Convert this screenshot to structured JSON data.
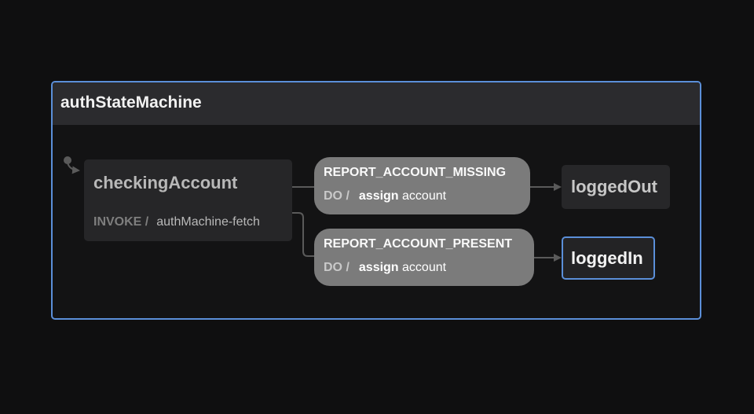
{
  "machine": {
    "title": "authStateMachine"
  },
  "states": {
    "checking": {
      "name": "checkingAccount",
      "invoke_keyword": "INVOKE /",
      "invoke_src": "authMachine-fetch"
    },
    "logged_out": {
      "name": "loggedOut"
    },
    "logged_in": {
      "name": "loggedIn"
    }
  },
  "events": {
    "missing": {
      "name": "REPORT_ACCOUNT_MISSING",
      "do_keyword": "DO /",
      "action": "assign",
      "action_arg": "account"
    },
    "present": {
      "name": "REPORT_ACCOUNT_PRESENT",
      "do_keyword": "DO /",
      "action": "assign",
      "action_arg": "account"
    }
  },
  "colors": {
    "accent": "#5b8fd9",
    "edge": "#5a5a5a",
    "event_bg": "#7b7b7b",
    "background": "#0f0f10"
  }
}
